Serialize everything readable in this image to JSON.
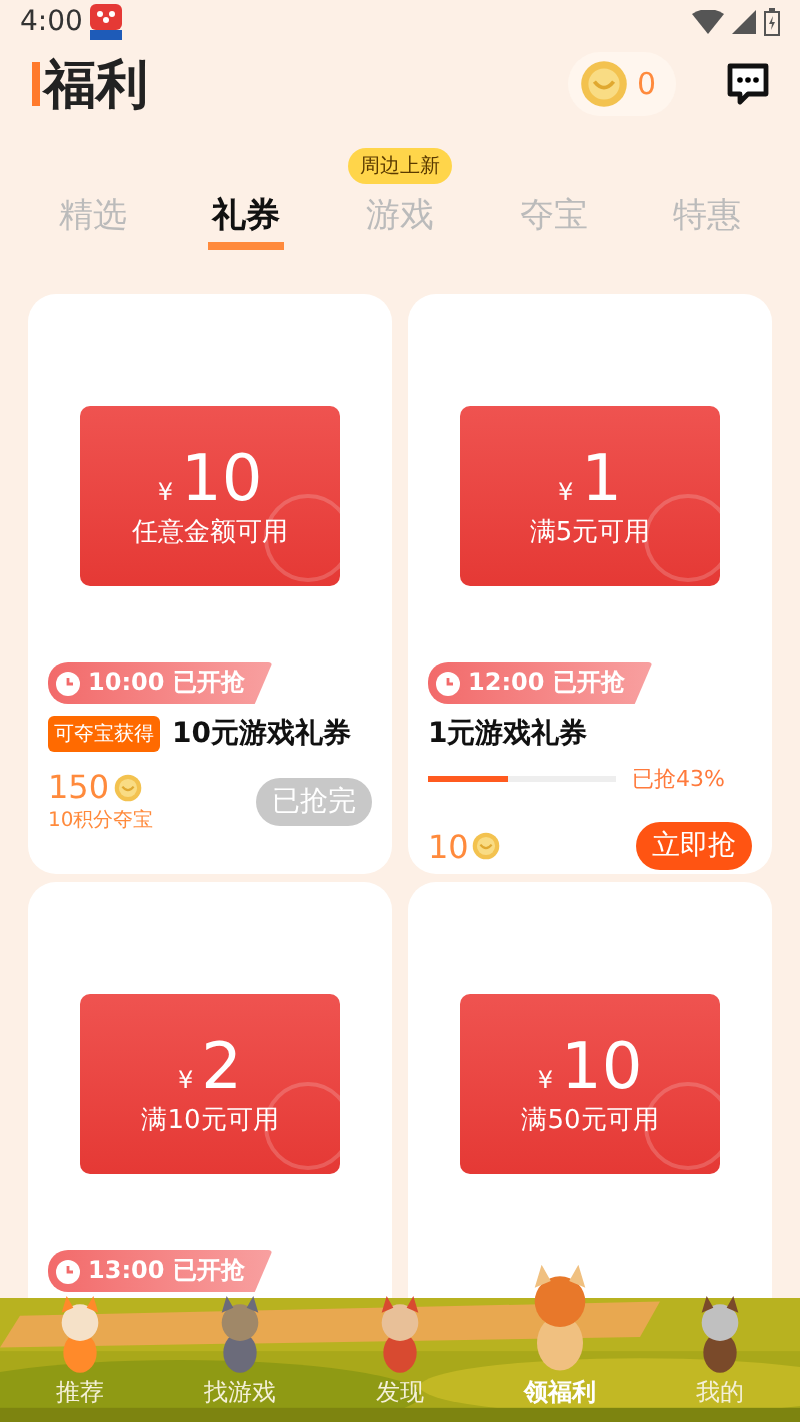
{
  "status_bar": {
    "time": "4:00"
  },
  "header": {
    "title": "福利",
    "coins": "0"
  },
  "tabs": [
    {
      "label": "精选",
      "selected": false
    },
    {
      "label": "礼券",
      "selected": true
    },
    {
      "label": "游戏",
      "selected": false,
      "badge": "周边上新"
    },
    {
      "label": "夺宝",
      "selected": false
    },
    {
      "label": "特惠",
      "selected": false
    }
  ],
  "cards": [
    {
      "currency": "¥",
      "amount": "10",
      "condition": "任意金额可用",
      "time": "10:00 已开抢",
      "tag": "可夺宝获得",
      "name": "10元游戏礼券",
      "price": "150",
      "price_note": "10积分夺宝",
      "button": {
        "label": "已抢完",
        "disabled": true
      }
    },
    {
      "currency": "¥",
      "amount": "1",
      "condition": "满5元可用",
      "time": "12:00 已开抢",
      "name": "1元游戏礼券",
      "level": 0.43,
      "progress_text": "已抢43%",
      "price": "10",
      "button": {
        "label": "立即抢",
        "disabled": false
      }
    },
    {
      "currency": "¥",
      "amount": "2",
      "condition": "满10元可用",
      "time": "13:00 已开抢"
    },
    {
      "currency": "¥",
      "amount": "10",
      "condition": "满50元可用"
    }
  ],
  "nav": [
    {
      "label": "推荐",
      "selected": false
    },
    {
      "label": "找游戏",
      "selected": false
    },
    {
      "label": "发现",
      "selected": false
    },
    {
      "label": "领福利",
      "selected": true
    },
    {
      "label": "我的",
      "selected": false
    }
  ]
}
